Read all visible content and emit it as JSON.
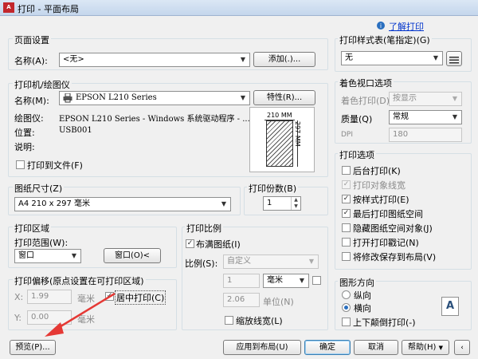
{
  "window": {
    "title": "打印 - 平面布局",
    "app_icon": "A"
  },
  "help_link": "了解打印",
  "page_setup": {
    "group_label": "页面设置",
    "name_label": "名称(A):",
    "name_value": "<无>",
    "add_button": "添加(.)..."
  },
  "printer": {
    "group_label": "打印机/绘图仪",
    "name_label": "名称(M):",
    "name_value": "EPSON L210 Series",
    "properties_button": "特性(R)...",
    "plotter_label": "绘图仪:",
    "plotter_value": "EPSON L210 Series - Windows 系统驱动程序 - ...",
    "location_label": "位置:",
    "location_value": "USB001",
    "description_label": "说明:",
    "print_to_file": "打印到文件(F)",
    "preview_width": "210 MM",
    "preview_height": "297 MM"
  },
  "paper_size": {
    "group_label": "图纸尺寸(Z)",
    "value": "A4 210 x 297 毫米"
  },
  "copies": {
    "label": "打印份数(B)",
    "value": "1"
  },
  "print_area": {
    "group_label": "打印区域",
    "range_label": "打印范围(W):",
    "range_value": "窗口",
    "window_button": "窗口(O)<"
  },
  "offset": {
    "group_label": "打印偏移(原点设置在可打印区域)",
    "x_label": "X:",
    "x_value": "1.99",
    "x_unit": "毫米",
    "y_label": "Y:",
    "y_value": "0.00",
    "y_unit": "毫米",
    "center_label": "居中打印(C)"
  },
  "scale": {
    "group_label": "打印比例",
    "fit_label": "布满图纸(I)",
    "ratio_label": "比例(S):",
    "ratio_value": "自定义",
    "value1": "1",
    "unit1": "毫米",
    "value2": "2.06",
    "unit2": "单位(N)",
    "lineweight_label": "缩放线宽(L)"
  },
  "plot_style": {
    "group_label": "打印样式表(笔指定)(G)",
    "value": "无"
  },
  "shaded_viewport": {
    "group_label": "着色视口选项",
    "shade_label": "着色打印(D)",
    "shade_value": "按显示",
    "quality_label": "质量(Q)",
    "quality_value": "常规",
    "dpi_label": "DPI",
    "dpi_value": "180"
  },
  "print_options": {
    "group_label": "打印选项",
    "items": [
      {
        "label": "后台打印(K)",
        "checked": "",
        "disabled": false
      },
      {
        "label": "打印对象线宽",
        "checked": "✓",
        "disabled": true
      },
      {
        "label": "按样式打印(E)",
        "checked": "✓",
        "disabled": false
      },
      {
        "label": "最后打印图纸空间",
        "checked": "✓",
        "disabled": false
      },
      {
        "label": "隐藏图纸空间对象(J)",
        "checked": "",
        "disabled": false
      },
      {
        "label": "打开打印戳记(N)",
        "checked": "",
        "disabled": false
      },
      {
        "label": "将修改保存到布局(V)",
        "checked": "",
        "disabled": false
      }
    ]
  },
  "orientation": {
    "group_label": "图形方向",
    "portrait": "纵向",
    "landscape": "横向",
    "landscape_selected": true,
    "upside_down": "上下颠倒打印(-)",
    "preview_glyph": "A"
  },
  "footer": {
    "preview_button": "预览(P)...",
    "apply_button": "应用到布局(U)",
    "ok_button": "确定",
    "cancel_button": "取消",
    "help_button": "帮助(H)"
  },
  "colors": {
    "accent": "#2a6fbf",
    "arrow": "#e53935",
    "link": "#0033cc"
  }
}
